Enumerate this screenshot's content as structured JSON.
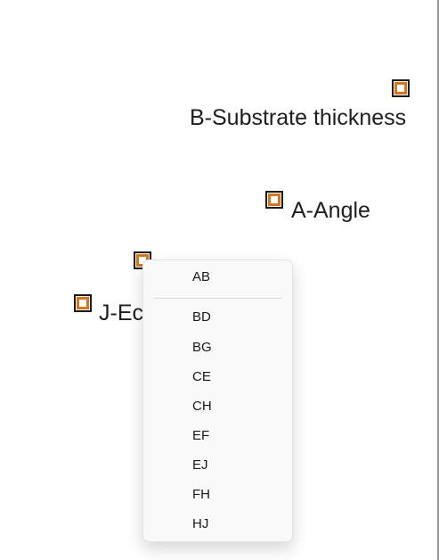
{
  "canvas": {
    "nodes": {
      "b": {
        "label": "B-Substrate thickness",
        "icon": "factor-node-icon"
      },
      "a": {
        "label": "A-Angle",
        "icon": "factor-node-icon"
      },
      "j": {
        "label": "J-Ec",
        "icon": "factor-node-icon"
      },
      "center": {
        "icon": "factor-node-icon"
      }
    }
  },
  "context_menu": {
    "items": [
      "AB",
      "BD",
      "BG",
      "CE",
      "CH",
      "EF",
      "EJ",
      "FH",
      "HJ"
    ]
  },
  "colors": {
    "marker_accent": "#d9741a",
    "marker_border": "#1a1a1a",
    "menu_background": "#f9f9f9"
  }
}
